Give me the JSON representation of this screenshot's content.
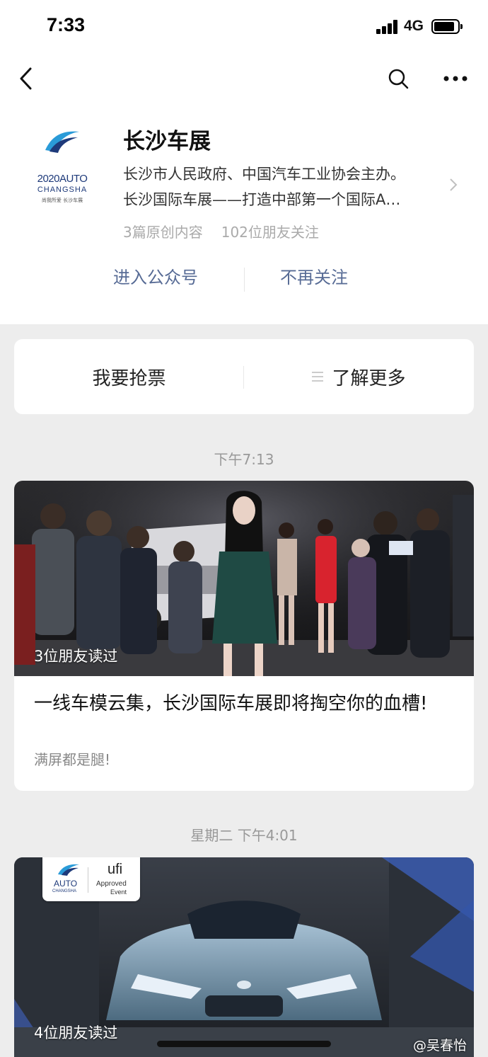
{
  "status_bar": {
    "time": "7:33",
    "network": "4G",
    "battery_level": 0.75
  },
  "nav": {
    "back_icon": "chevron-left-icon",
    "search_icon": "search-icon",
    "more_icon": "more-horizontal-icon"
  },
  "account": {
    "logo": {
      "line1": "2020AUTO",
      "line2": "CHANGSHA",
      "line3": "尚我所爱 长沙车展"
    },
    "name": "长沙车展",
    "description_line1": "长沙市人民政府、中国汽车工业协会主办。",
    "description_line2": "长沙国际车展——打造中部第一个国际A…",
    "original_count": "3篇原创内容",
    "friends_following": "102位朋友关注",
    "enter_label": "进入公众号",
    "unfollow_label": "不再关注"
  },
  "menu": {
    "buy_ticket": "我要抢票",
    "learn_more": "了解更多"
  },
  "articles": [
    {
      "timestamp": "下午7:13",
      "read_by": "3位朋友读过",
      "title": "一线车模云集，长沙国际车展即将掏空你的血槽!",
      "digest": "满屏都是腿!"
    },
    {
      "timestamp": "星期二 下午4:01",
      "read_by": "4位朋友读过",
      "badge_auto": "AUTO",
      "badge_changsha": "CHANGSHA",
      "badge_ufi": "ufi",
      "badge_approved": "Approved",
      "badge_event": "Event"
    }
  ],
  "watermark": "@吴春怡",
  "colors": {
    "link": "#576b95",
    "background": "#ededed",
    "card": "#ffffff",
    "muted": "#999999"
  }
}
